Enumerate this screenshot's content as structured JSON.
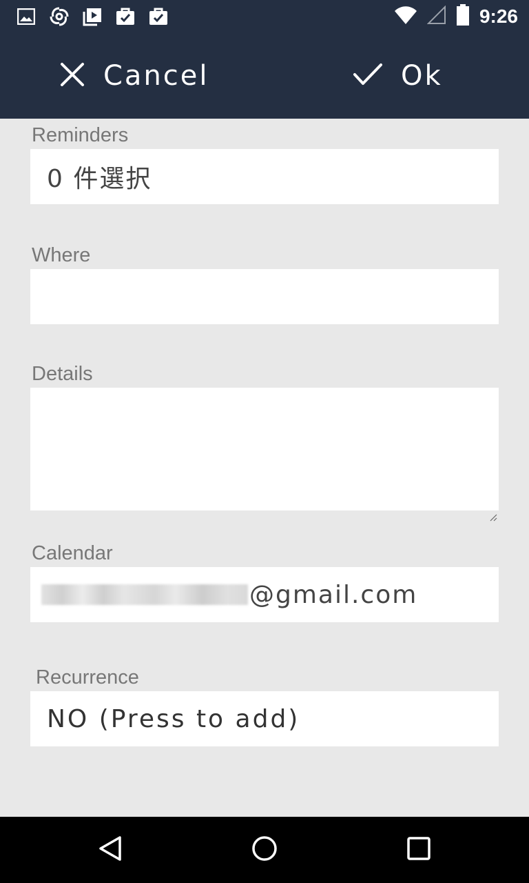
{
  "status_bar": {
    "time": "9:26",
    "left_icons": [
      "image-icon",
      "sync-spiral-icon",
      "media-library-icon",
      "briefcase-check-icon",
      "briefcase-check-icon"
    ],
    "right_icons": [
      "wifi-icon",
      "cellular-signal-icon",
      "battery-icon"
    ]
  },
  "action_bar": {
    "cancel_label": "Cancel",
    "ok_label": "Ok",
    "background": "#242f42"
  },
  "form": {
    "reminders": {
      "label": "Reminders",
      "value": "0 件選択"
    },
    "where": {
      "label": "Where",
      "value": ""
    },
    "details": {
      "label": "Details",
      "value": ""
    },
    "calendar": {
      "label": "Calendar",
      "value_suffix": "@gmail.com"
    },
    "recurrence": {
      "label": "Recurrence",
      "value": "NO (Press to add)"
    }
  },
  "nav_bar": {
    "buttons": [
      "back-icon",
      "home-icon",
      "recents-icon"
    ]
  }
}
